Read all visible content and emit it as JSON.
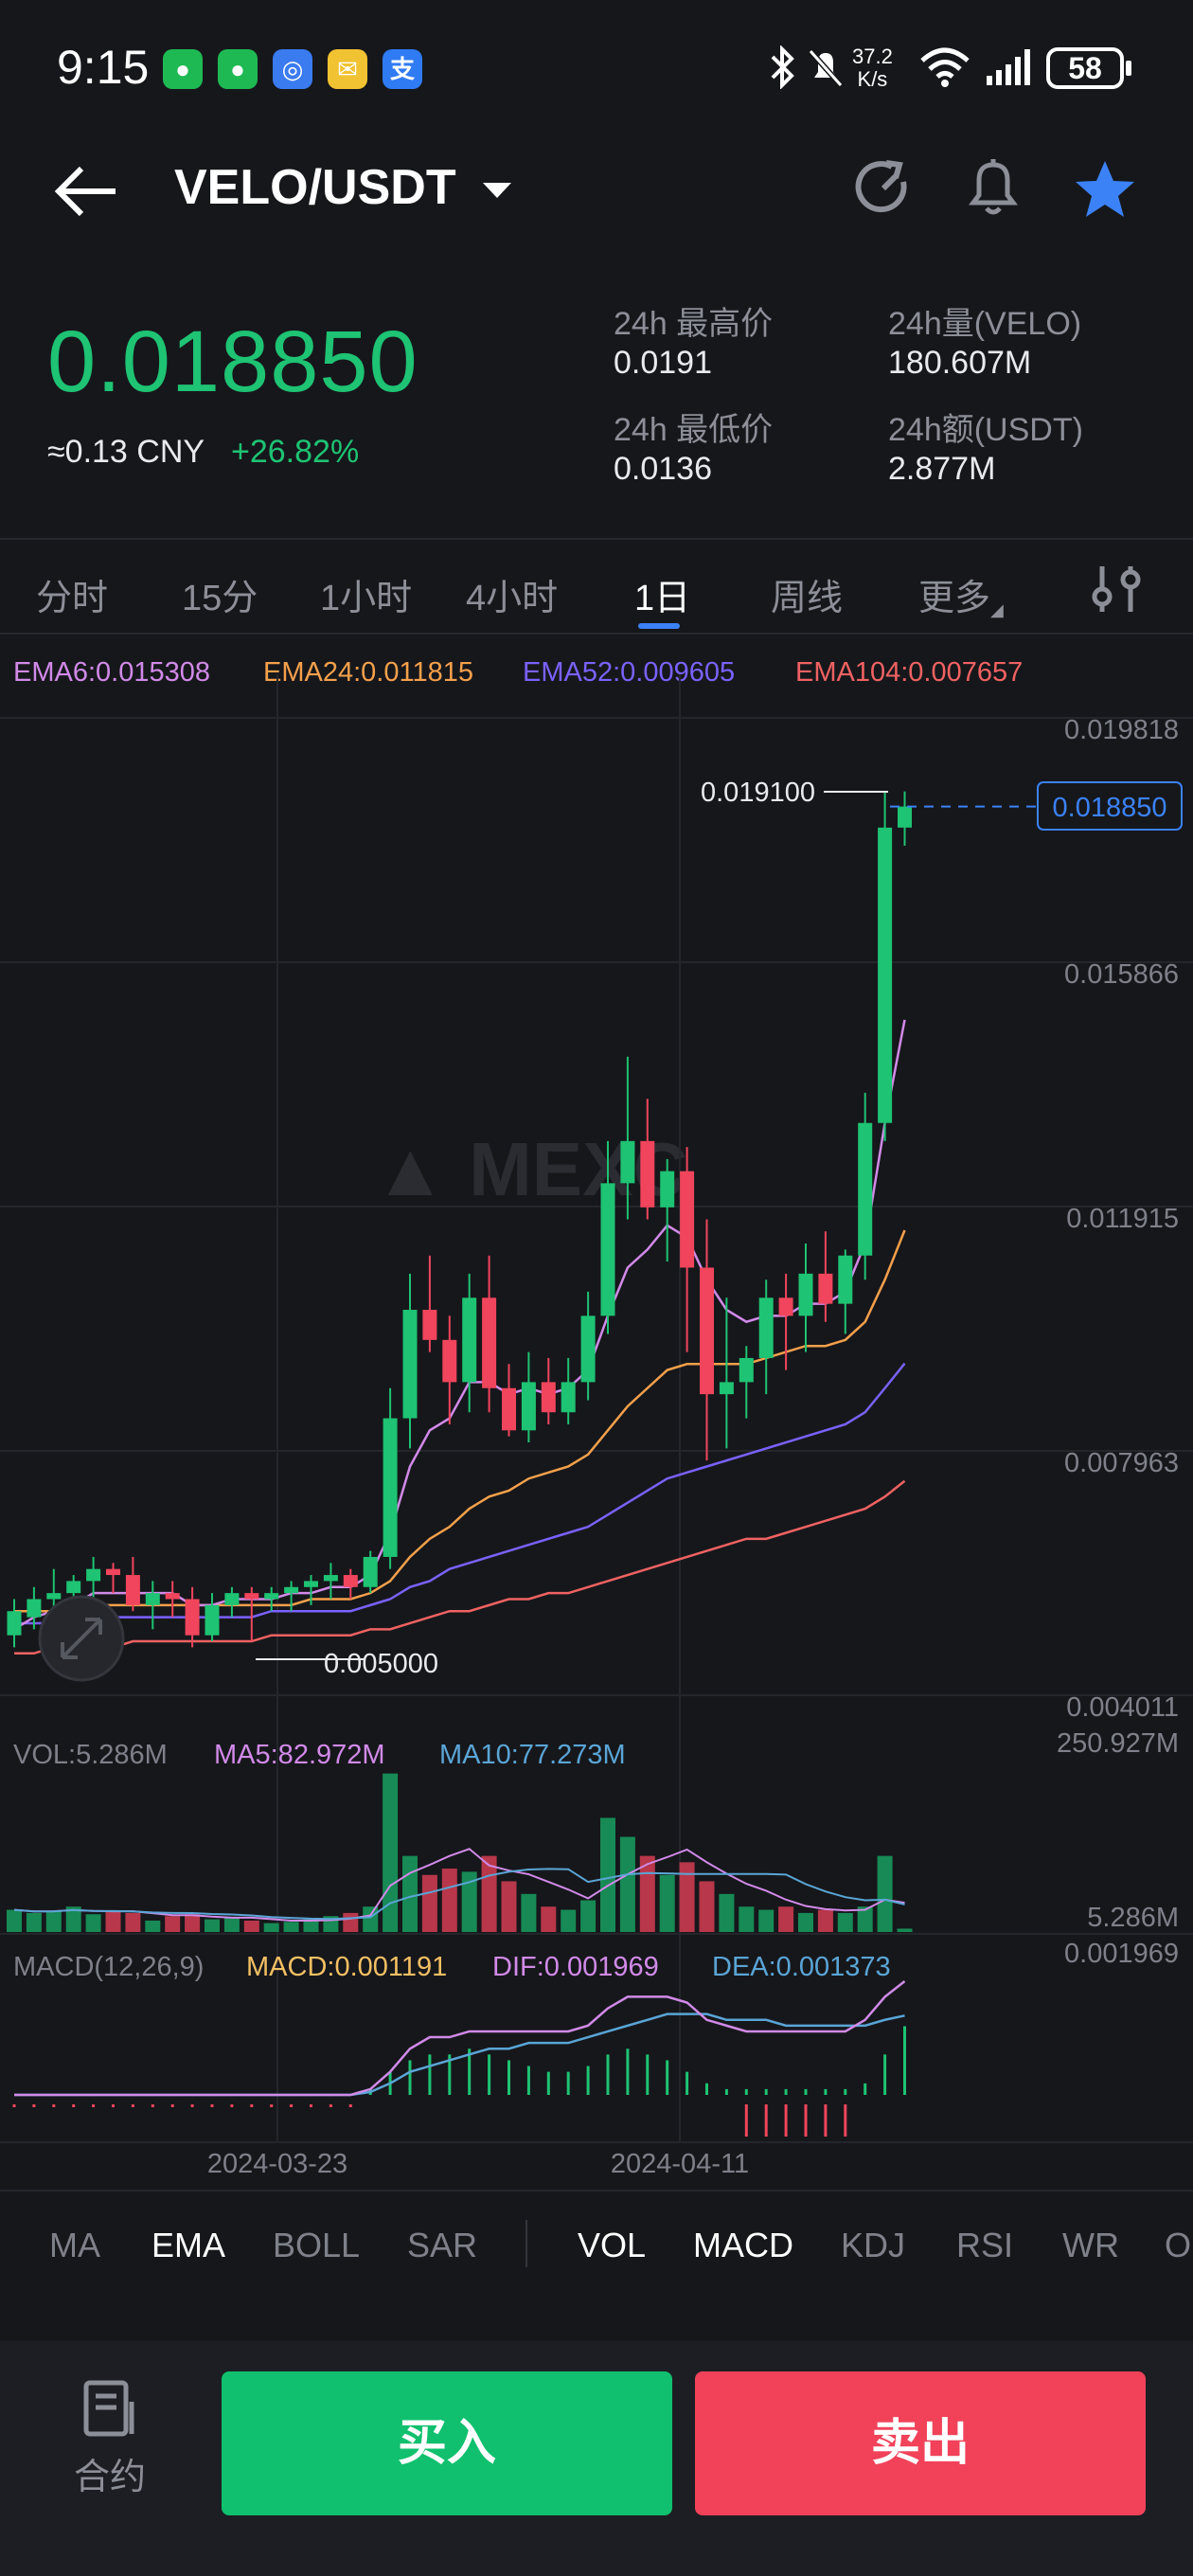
{
  "status_bar": {
    "time": "9:15",
    "net_speed_value": "37.2",
    "net_speed_unit": "K/s",
    "battery": "58",
    "app_icons": [
      "wechat-icon",
      "wechat-icon",
      "browser-icon",
      "mail-icon",
      "alipay-icon"
    ],
    "alipay_glyph": "支"
  },
  "header": {
    "pair": "VELO/USDT",
    "last_price": "0.018850",
    "cny_value": "≈0.13 CNY",
    "change_pct": "+26.82%",
    "stats": {
      "high_label": "24h 最高价",
      "high_value": "0.0191",
      "low_label": "24h 最低价",
      "low_value": "0.0136",
      "vol_label": "24h量(VELO)",
      "vol_value": "180.607M",
      "amt_label": "24h额(USDT)",
      "amt_value": "2.877M"
    }
  },
  "tabs": {
    "items": [
      "分时",
      "15分",
      "1小时",
      "4小时",
      "1日",
      "周线",
      "更多"
    ],
    "active": "1日"
  },
  "chart": {
    "ema_labels": {
      "ema6": "EMA6:0.015308",
      "ema24": "EMA24:0.011815",
      "ema52": "EMA52:0.009605",
      "ema104": "EMA104:0.007657"
    },
    "price_axis_labels": [
      "0.019818",
      "0.015866",
      "0.011915",
      "0.007963",
      "0.004011"
    ],
    "high_marker": "0.019100",
    "low_marker": "0.005000",
    "current_price_tag": "0.018850",
    "watermark": "MEXC",
    "vol_labels": {
      "vol": "VOL:5.286M",
      "ma5": "MA5:82.972M",
      "ma10": "MA10:77.273M",
      "axis_top": "250.927M",
      "axis_bottom": "5.286M"
    },
    "macd_labels": {
      "title": "MACD(12,26,9)",
      "macd": "MACD:0.001191",
      "dif": "DIF:0.001969",
      "dea": "DEA:0.001373",
      "axis_top": "0.001969"
    },
    "date_labels": [
      "2024-03-23",
      "2024-04-11"
    ],
    "colors": {
      "up": "#1ec373",
      "down": "#f0455c",
      "ema6": "#d18ae8",
      "ema24": "#f5a04b",
      "ema52": "#7b61ff",
      "ema104": "#f06262",
      "dea": "#5aa5d6",
      "macd_label": "#f3c063",
      "accent": "#3b82f6"
    }
  },
  "chart_data": {
    "type": "candlestick",
    "interval": "1日",
    "ylim": [
      0.004011,
      0.019818
    ],
    "y_ticks": [
      0.019818,
      0.015866,
      0.011915,
      0.007963,
      0.004011
    ],
    "x_tick_labels": [
      "2024-03-23",
      "2024-04-11"
    ],
    "candles": [
      [
        0.0051,
        0.0057,
        0.0049,
        0.0055
      ],
      [
        0.0054,
        0.0059,
        0.0052,
        0.0057
      ],
      [
        0.0057,
        0.0062,
        0.0054,
        0.0058
      ],
      [
        0.0058,
        0.0061,
        0.0055,
        0.006
      ],
      [
        0.006,
        0.0064,
        0.0057,
        0.0062
      ],
      [
        0.0062,
        0.0063,
        0.0058,
        0.0061
      ],
      [
        0.0061,
        0.0064,
        0.0055,
        0.0056
      ],
      [
        0.0056,
        0.006,
        0.0052,
        0.0058
      ],
      [
        0.0058,
        0.006,
        0.0054,
        0.0057
      ],
      [
        0.0057,
        0.0059,
        0.0049,
        0.0051
      ],
      [
        0.0051,
        0.0058,
        0.005,
        0.0056
      ],
      [
        0.0056,
        0.0059,
        0.0054,
        0.0058
      ],
      [
        0.0058,
        0.0059,
        0.005,
        0.0057
      ],
      [
        0.0057,
        0.0059,
        0.0055,
        0.0058
      ],
      [
        0.0058,
        0.006,
        0.0055,
        0.0059
      ],
      [
        0.0059,
        0.0061,
        0.0056,
        0.006
      ],
      [
        0.006,
        0.0063,
        0.0057,
        0.0061
      ],
      [
        0.0061,
        0.0062,
        0.0057,
        0.0059
      ],
      [
        0.0059,
        0.0065,
        0.0058,
        0.0064
      ],
      [
        0.0064,
        0.0092,
        0.0062,
        0.0087
      ],
      [
        0.0087,
        0.0111,
        0.0082,
        0.0105
      ],
      [
        0.0105,
        0.0114,
        0.0098,
        0.01
      ],
      [
        0.01,
        0.0104,
        0.0086,
        0.0093
      ],
      [
        0.0093,
        0.0111,
        0.0088,
        0.0107
      ],
      [
        0.0107,
        0.0114,
        0.0088,
        0.0092
      ],
      [
        0.0092,
        0.0096,
        0.0084,
        0.0085
      ],
      [
        0.0085,
        0.0098,
        0.0083,
        0.0093
      ],
      [
        0.0093,
        0.0097,
        0.0086,
        0.0088
      ],
      [
        0.0088,
        0.0097,
        0.0086,
        0.0093
      ],
      [
        0.0093,
        0.0108,
        0.009,
        0.0104
      ],
      [
        0.0104,
        0.0133,
        0.0101,
        0.0126
      ],
      [
        0.0126,
        0.0147,
        0.012,
        0.0133
      ],
      [
        0.0133,
        0.014,
        0.012,
        0.0122
      ],
      [
        0.0122,
        0.013,
        0.0113,
        0.0128
      ],
      [
        0.0128,
        0.0132,
        0.0098,
        0.0112
      ],
      [
        0.0112,
        0.012,
        0.008,
        0.0091
      ],
      [
        0.0091,
        0.0107,
        0.0082,
        0.0093
      ],
      [
        0.0093,
        0.0099,
        0.0087,
        0.0097
      ],
      [
        0.0097,
        0.011,
        0.0091,
        0.0107
      ],
      [
        0.0107,
        0.0111,
        0.0095,
        0.0104
      ],
      [
        0.0104,
        0.0116,
        0.0098,
        0.0111
      ],
      [
        0.0111,
        0.0118,
        0.0103,
        0.0106
      ],
      [
        0.0106,
        0.0115,
        0.0101,
        0.0114
      ],
      [
        0.0114,
        0.0141,
        0.011,
        0.0136
      ],
      [
        0.0136,
        0.0191,
        0.0133,
        0.0185
      ],
      [
        0.0185,
        0.0191,
        0.0182,
        0.01885
      ]
    ],
    "ema6": [
      0.0052,
      0.0054,
      0.0055,
      0.0056,
      0.0058,
      0.0058,
      0.0058,
      0.0058,
      0.0058,
      0.0056,
      0.0056,
      0.0057,
      0.0057,
      0.0057,
      0.0058,
      0.0058,
      0.0059,
      0.0059,
      0.0061,
      0.0068,
      0.0079,
      0.0085,
      0.0087,
      0.0093,
      0.0093,
      0.0091,
      0.0092,
      0.0091,
      0.0092,
      0.0095,
      0.0104,
      0.0112,
      0.0115,
      0.0119,
      0.0117,
      0.011,
      0.0105,
      0.0103,
      0.0104,
      0.0104,
      0.0106,
      0.0106,
      0.0108,
      0.0116,
      0.0136,
      0.01531
    ],
    "ema24": [
      0.0055,
      0.0055,
      0.0055,
      0.0056,
      0.0056,
      0.0056,
      0.0056,
      0.0056,
      0.0056,
      0.0056,
      0.0056,
      0.0056,
      0.0056,
      0.0056,
      0.0056,
      0.0057,
      0.0057,
      0.0057,
      0.0058,
      0.006,
      0.0064,
      0.0067,
      0.0069,
      0.0072,
      0.0074,
      0.0075,
      0.0077,
      0.0078,
      0.0079,
      0.0081,
      0.0085,
      0.0089,
      0.0092,
      0.0095,
      0.0096,
      0.0096,
      0.0096,
      0.0096,
      0.0097,
      0.0098,
      0.0099,
      0.0099,
      0.01,
      0.0103,
      0.011,
      0.01182
    ],
    "ema52": [
      0.0053,
      0.0053,
      0.0053,
      0.0053,
      0.0053,
      0.0054,
      0.0054,
      0.0054,
      0.0054,
      0.0054,
      0.0054,
      0.0054,
      0.0054,
      0.0055,
      0.0055,
      0.0055,
      0.0055,
      0.0055,
      0.0056,
      0.0057,
      0.0059,
      0.006,
      0.0062,
      0.0063,
      0.0064,
      0.0065,
      0.0066,
      0.0067,
      0.0068,
      0.0069,
      0.0071,
      0.0073,
      0.0075,
      0.0077,
      0.0078,
      0.0079,
      0.008,
      0.0081,
      0.0082,
      0.0083,
      0.0084,
      0.0085,
      0.0086,
      0.0088,
      0.0092,
      0.00961
    ],
    "ema104": [
      0.0048,
      0.0048,
      0.0049,
      0.0049,
      0.0049,
      0.0049,
      0.005,
      0.005,
      0.005,
      0.005,
      0.005,
      0.005,
      0.005,
      0.0051,
      0.0051,
      0.0051,
      0.0051,
      0.0051,
      0.0052,
      0.0052,
      0.0053,
      0.0054,
      0.0055,
      0.0055,
      0.0056,
      0.0057,
      0.0057,
      0.0058,
      0.0058,
      0.0059,
      0.006,
      0.0061,
      0.0062,
      0.0063,
      0.0064,
      0.0065,
      0.0066,
      0.0067,
      0.0067,
      0.0068,
      0.0069,
      0.007,
      0.0071,
      0.0072,
      0.0074,
      0.00766
    ],
    "volume_axis": [
      5.286,
      250.927
    ],
    "volume": [
      35,
      30,
      33,
      40,
      28,
      32,
      30,
      18,
      25,
      28,
      20,
      22,
      18,
      14,
      16,
      20,
      25,
      30,
      40,
      250,
      120,
      90,
      100,
      95,
      120,
      80,
      60,
      40,
      35,
      50,
      180,
      150,
      120,
      90,
      110,
      80,
      60,
      40,
      35,
      40,
      30,
      35,
      30,
      40,
      120,
      5.286
    ],
    "macd_axis_top": 0.001969,
    "macd_hist": [
      0,
      0,
      0,
      0,
      0,
      0,
      0,
      0,
      0,
      0,
      0,
      0,
      0,
      0,
      0,
      0,
      0,
      0,
      0.0001,
      0.0004,
      0.0006,
      0.0007,
      0.0007,
      0.0008,
      0.0007,
      0.0006,
      0.0005,
      0.0004,
      0.0004,
      0.0005,
      0.0007,
      0.0008,
      0.0007,
      0.0006,
      0.0004,
      0.0002,
      0.0001,
      0.0001,
      0.0001,
      0.0001,
      0.0001,
      0.0001,
      0.0001,
      0.0002,
      0.0007,
      0.00119
    ],
    "dif": [
      0,
      0,
      0,
      0,
      0,
      0,
      0,
      0,
      0,
      0,
      0,
      0,
      0,
      0,
      0,
      0,
      0,
      0,
      0.0001,
      0.0004,
      0.0008,
      0.001,
      0.001,
      0.0011,
      0.0011,
      0.0011,
      0.0011,
      0.0011,
      0.0011,
      0.0012,
      0.0015,
      0.0017,
      0.0017,
      0.0017,
      0.0016,
      0.0013,
      0.0012,
      0.0011,
      0.0011,
      0.0011,
      0.0011,
      0.0011,
      0.0011,
      0.0013,
      0.0017,
      0.001969
    ],
    "dea": [
      0,
      0,
      0,
      0,
      0,
      0,
      0,
      0,
      0,
      0,
      0,
      0,
      0,
      0,
      0,
      0,
      0,
      0,
      5e-05,
      0.0002,
      0.0004,
      0.0005,
      0.0006,
      0.0007,
      0.0008,
      0.0008,
      0.0009,
      0.0009,
      0.0009,
      0.001,
      0.0011,
      0.0012,
      0.0013,
      0.0014,
      0.0014,
      0.0014,
      0.0013,
      0.0013,
      0.0013,
      0.0012,
      0.0012,
      0.0012,
      0.0012,
      0.0012,
      0.0013,
      0.001373
    ]
  },
  "indicators": {
    "main": [
      "MA",
      "EMA",
      "BOLL",
      "SAR"
    ],
    "main_active": "EMA",
    "sub": [
      "VOL",
      "MACD",
      "KDJ",
      "RSI",
      "WR",
      "O"
    ],
    "sub_active": [
      "VOL",
      "MACD"
    ]
  },
  "bottom": {
    "contract_label": "合约",
    "buy_label": "买入",
    "sell_label": "卖出"
  }
}
